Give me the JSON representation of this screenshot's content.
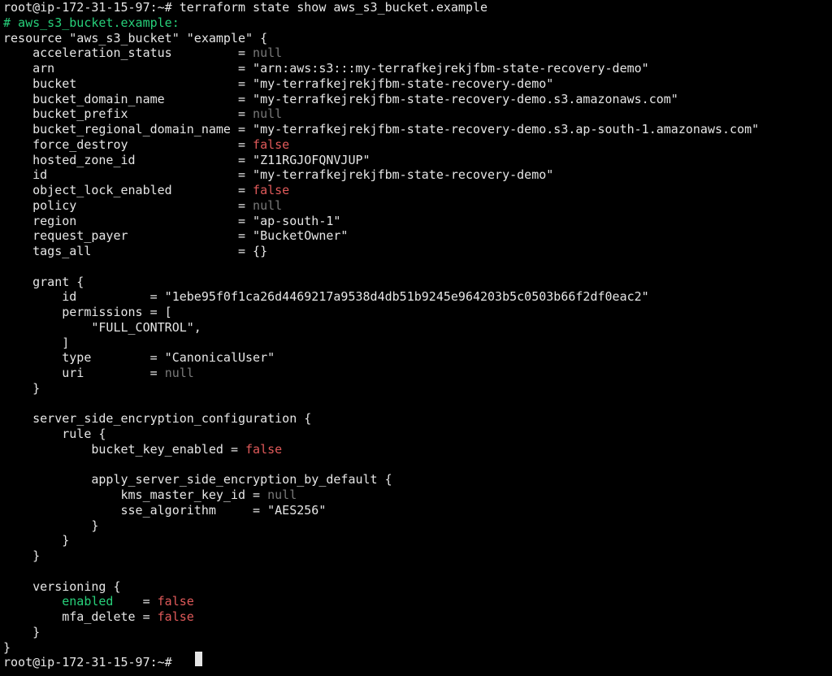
{
  "terminal": {
    "lines": [
      {
        "segments": [
          {
            "text": "root@ip-172-31-15-97:~# terraform state show aws_s3_bucket.example",
            "kind": "plain"
          }
        ]
      },
      {
        "segments": [
          {
            "text": "# aws_s3_bucket.example:",
            "kind": "green"
          }
        ]
      },
      {
        "segments": [
          {
            "text": "resource \"aws_s3_bucket\" \"example\" {",
            "kind": "plain"
          }
        ]
      },
      {
        "segments": [
          {
            "text": "    acceleration_status         = ",
            "kind": "plain"
          },
          {
            "text": "null",
            "kind": "null"
          }
        ]
      },
      {
        "segments": [
          {
            "text": "    arn                         = \"arn:aws:s3:::my-terrafkejrekjfbm-state-recovery-demo\"",
            "kind": "plain"
          }
        ]
      },
      {
        "segments": [
          {
            "text": "    bucket                      = \"my-terrafkejrekjfbm-state-recovery-demo\"",
            "kind": "plain"
          }
        ]
      },
      {
        "segments": [
          {
            "text": "    bucket_domain_name          = \"my-terrafkejrekjfbm-state-recovery-demo.s3.amazonaws.com\"",
            "kind": "plain"
          }
        ]
      },
      {
        "segments": [
          {
            "text": "    bucket_prefix               = ",
            "kind": "plain"
          },
          {
            "text": "null",
            "kind": "null"
          }
        ]
      },
      {
        "segments": [
          {
            "text": "    bucket_regional_domain_name = \"my-terrafkejrekjfbm-state-recovery-demo.s3.ap-south-1.amazonaws.com\"",
            "kind": "plain"
          }
        ]
      },
      {
        "segments": [
          {
            "text": "    force_destroy               = ",
            "kind": "plain"
          },
          {
            "text": "false",
            "kind": "false"
          }
        ]
      },
      {
        "segments": [
          {
            "text": "    hosted_zone_id              = \"Z11RGJOFQNVJUP\"",
            "kind": "plain"
          }
        ]
      },
      {
        "segments": [
          {
            "text": "    id                          = \"my-terrafkejrekjfbm-state-recovery-demo\"",
            "kind": "plain"
          }
        ]
      },
      {
        "segments": [
          {
            "text": "    object_lock_enabled         = ",
            "kind": "plain"
          },
          {
            "text": "false",
            "kind": "false"
          }
        ]
      },
      {
        "segments": [
          {
            "text": "    policy                      = ",
            "kind": "plain"
          },
          {
            "text": "null",
            "kind": "null"
          }
        ]
      },
      {
        "segments": [
          {
            "text": "    region                      = \"ap-south-1\"",
            "kind": "plain"
          }
        ]
      },
      {
        "segments": [
          {
            "text": "    request_payer               = \"BucketOwner\"",
            "kind": "plain"
          }
        ]
      },
      {
        "segments": [
          {
            "text": "    tags_all                    = {}",
            "kind": "plain"
          }
        ]
      },
      {
        "segments": [
          {
            "text": "",
            "kind": "plain"
          }
        ]
      },
      {
        "segments": [
          {
            "text": "    grant {",
            "kind": "plain"
          }
        ]
      },
      {
        "segments": [
          {
            "text": "        id          = \"1ebe95f0f1ca26d4469217a9538d4db51b9245e964203b5c0503b66f2df0eac2\"",
            "kind": "plain"
          }
        ]
      },
      {
        "segments": [
          {
            "text": "        permissions = [",
            "kind": "plain"
          }
        ]
      },
      {
        "segments": [
          {
            "text": "            \"FULL_CONTROL\",",
            "kind": "plain"
          }
        ]
      },
      {
        "segments": [
          {
            "text": "        ]",
            "kind": "plain"
          }
        ]
      },
      {
        "segments": [
          {
            "text": "        type        = \"CanonicalUser\"",
            "kind": "plain"
          }
        ]
      },
      {
        "segments": [
          {
            "text": "        uri         = ",
            "kind": "plain"
          },
          {
            "text": "null",
            "kind": "null"
          }
        ]
      },
      {
        "segments": [
          {
            "text": "    }",
            "kind": "plain"
          }
        ]
      },
      {
        "segments": [
          {
            "text": "",
            "kind": "plain"
          }
        ]
      },
      {
        "segments": [
          {
            "text": "    server_side_encryption_configuration {",
            "kind": "plain"
          }
        ]
      },
      {
        "segments": [
          {
            "text": "        rule {",
            "kind": "plain"
          }
        ]
      },
      {
        "segments": [
          {
            "text": "            bucket_key_enabled = ",
            "kind": "plain"
          },
          {
            "text": "false",
            "kind": "false"
          }
        ]
      },
      {
        "segments": [
          {
            "text": "",
            "kind": "plain"
          }
        ]
      },
      {
        "segments": [
          {
            "text": "            apply_server_side_encryption_by_default {",
            "kind": "plain"
          }
        ]
      },
      {
        "segments": [
          {
            "text": "                kms_master_key_id = ",
            "kind": "plain"
          },
          {
            "text": "null",
            "kind": "null"
          }
        ]
      },
      {
        "segments": [
          {
            "text": "                sse_algorithm     = \"AES256\"",
            "kind": "plain"
          }
        ]
      },
      {
        "segments": [
          {
            "text": "            }",
            "kind": "plain"
          }
        ]
      },
      {
        "segments": [
          {
            "text": "        }",
            "kind": "plain"
          }
        ]
      },
      {
        "segments": [
          {
            "text": "    }",
            "kind": "plain"
          }
        ]
      },
      {
        "segments": [
          {
            "text": "",
            "kind": "plain"
          }
        ]
      },
      {
        "segments": [
          {
            "text": "    versioning {",
            "kind": "plain"
          }
        ]
      },
      {
        "segments": [
          {
            "text": "        ",
            "kind": "plain"
          },
          {
            "text": "enabled",
            "kind": "green"
          },
          {
            "text": "    = ",
            "kind": "plain"
          },
          {
            "text": "false",
            "kind": "false"
          }
        ]
      },
      {
        "segments": [
          {
            "text": "        mfa_delete = ",
            "kind": "plain"
          },
          {
            "text": "false",
            "kind": "false"
          }
        ]
      },
      {
        "segments": [
          {
            "text": "    }",
            "kind": "plain"
          }
        ]
      },
      {
        "segments": [
          {
            "text": "}",
            "kind": "plain"
          }
        ]
      },
      {
        "segments": [
          {
            "text": "root@ip-172-31-15-97:~# ",
            "kind": "plain"
          }
        ]
      }
    ]
  },
  "colors": {
    "background": "#000000",
    "text": "#e6e6e6",
    "false": "#e05a5a",
    "null": "#7a7a7a",
    "green": "#27d07a"
  }
}
